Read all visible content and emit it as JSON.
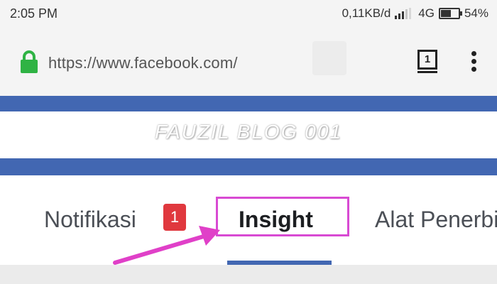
{
  "status_bar": {
    "time": "2:05 PM",
    "network_speed": "0,11KB/d",
    "network_type": "4G",
    "battery": "54%",
    "battery_level": 0.54
  },
  "browser": {
    "url": "https://www.facebook.com/",
    "tab_count": "1",
    "icons": [
      "lock-icon",
      "tabs-icon",
      "more-icon"
    ]
  },
  "page": {
    "watermark": "FAUZIL BLOG 001",
    "tabs": [
      {
        "label": "Notifikasi",
        "badge": "1"
      },
      {
        "label": "Insight"
      },
      {
        "label": "Alat Penerbitan"
      }
    ]
  },
  "colors": {
    "facebook_blue": "#4267b2",
    "highlight": "#d84ad3",
    "badge_red": "#e0383e"
  }
}
